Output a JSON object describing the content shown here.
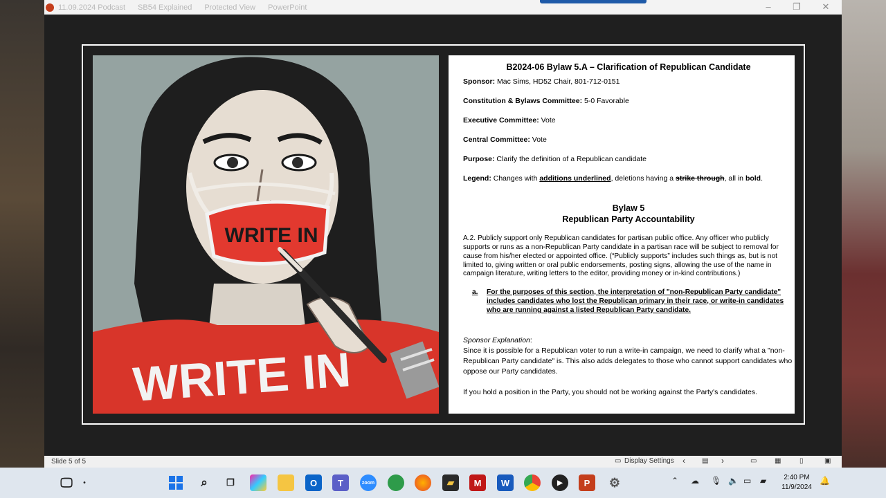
{
  "window": {
    "title_segments": [
      "11.09.2024 Podcast",
      "SB54 Explained",
      "Protected View",
      "PowerPoint"
    ]
  },
  "art": {
    "mask_text": "WRITE IN",
    "shirt_text": "WRITE IN"
  },
  "doc": {
    "title": "B2024-06 Bylaw 5.A – Clarification of Republican Candidate",
    "sponsor_label": "Sponsor:",
    "sponsor_value": " Mac Sims, HD52 Chair, 801-712-0151",
    "cbc_label": "Constitution & Bylaws Committee:",
    "cbc_value": " 5-0 Favorable",
    "exec_label": "Executive Committee:",
    "exec_value": " Vote",
    "central_label": "Central Committee:",
    "central_value": " Vote",
    "purpose_label": "Purpose:",
    "purpose_value": " Clarify the definition of a Republican candidate",
    "legend_label": "Legend:",
    "legend_part1": " Changes with ",
    "legend_additions": "additions underlined",
    "legend_part2": ", deletions having a ",
    "legend_strike": "strike through",
    "legend_part3": ", all in ",
    "legend_bold": "bold",
    "legend_end": ".",
    "bylaw_heading": "Bylaw 5",
    "bylaw_subheading": "Republican Party Accountability",
    "a2_text": "A.2. Publicly support only Republican candidates for partisan public office. Any officer who publicly supports or runs as a non-Republican Party candidate in a partisan race will be subject to removal for cause from his/her elected or appointed office. (“Publicly supports” includes such things as, but is not limited to, giving written or oral public endorsements, posting signs, allowing the use of the name in campaign literature, writing letters to the editor, providing money or in-kind contributions.)",
    "sub_a_label": "a.",
    "sub_a_text": "For the purposes of this section, the interpretation of \"non-Republican Party candidate\" includes candidates who lost the Republican primary in their race, or write-in candidates who are running against a listed Republican Party candidate.",
    "explanation_label": "Sponsor Explanation",
    "explanation_colon": ":",
    "explanation_text": "Since it is possible for a Republican voter to run a write-in campaign, we need to clarify what a \"non-Republican Party candidate\" is. This also adds delegates to those who cannot support candidates who oppose our Party candidates.",
    "closing_text": "If you hold a position in the Party, you should not be working against the Party's candidates."
  },
  "statusbar": {
    "slide_info": "Slide 5 of 5",
    "display_settings": "Display Settings"
  },
  "taskbar": {
    "time": "2:40 PM",
    "date": "11/9/2024",
    "zoom_label": "zoom"
  },
  "colors": {
    "powerpoint_accent": "#c43e1c",
    "mask_red": "#e2392f",
    "taskbar_bg": "#dfe6ee"
  }
}
